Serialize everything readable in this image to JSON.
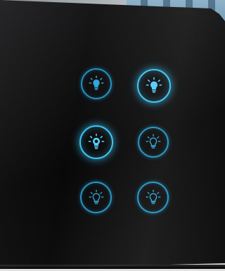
{
  "colors": {
    "glow": "#38c4f5",
    "ring": "#1e93c2",
    "glass": "#0a0a0b"
  },
  "buttons": [
    {
      "id": "top-left",
      "icon": "bulb-icon",
      "state": "on"
    },
    {
      "id": "top-right",
      "icon": "bulb-icon",
      "state": "on"
    },
    {
      "id": "middle-left",
      "icon": "bulb-icon",
      "state": "on"
    },
    {
      "id": "middle-right",
      "icon": "bulb-icon",
      "state": "off"
    },
    {
      "id": "bottom-left",
      "icon": "bulb-icon",
      "state": "off"
    },
    {
      "id": "bottom-right",
      "icon": "bulb-icon",
      "state": "off"
    }
  ]
}
